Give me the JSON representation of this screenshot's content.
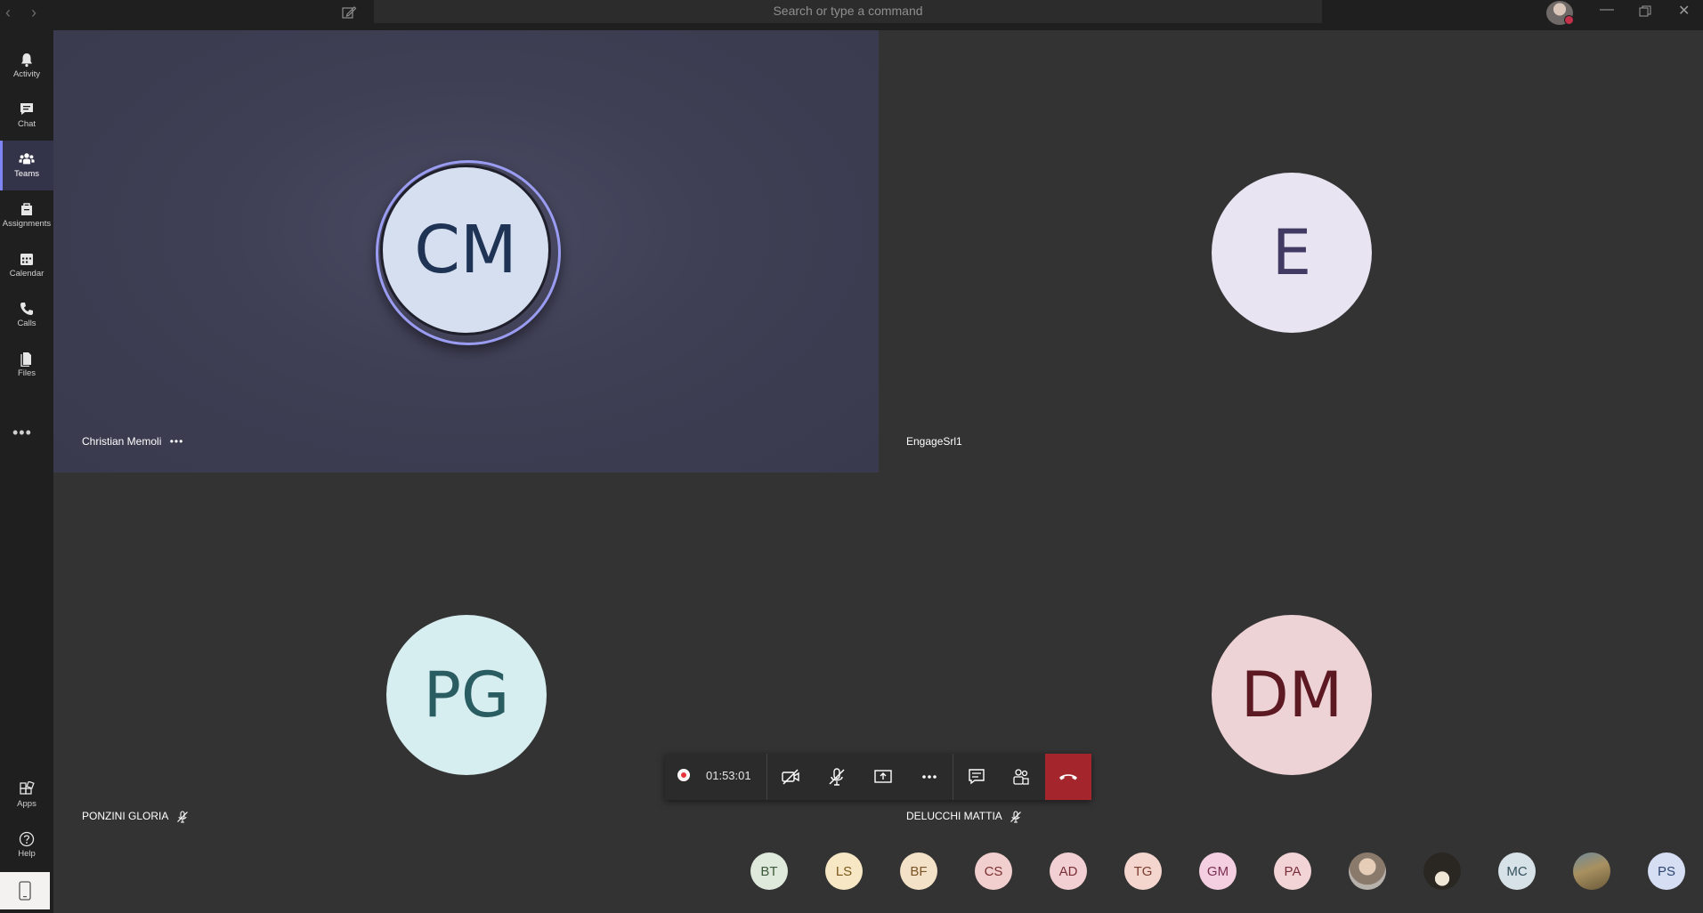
{
  "titlebar": {
    "search_placeholder": "Search or type a command",
    "back_icon": "chevron-left-icon",
    "forward_icon": "chevron-right-icon",
    "compose_icon": "compose-icon"
  },
  "rail": {
    "items": [
      {
        "label": "Activity",
        "icon": "bell-icon"
      },
      {
        "label": "Chat",
        "icon": "chat-icon"
      },
      {
        "label": "Teams",
        "icon": "teams-icon",
        "active": true
      },
      {
        "label": "Assignments",
        "icon": "assignments-icon"
      },
      {
        "label": "Calendar",
        "icon": "calendar-icon"
      },
      {
        "label": "Calls",
        "icon": "phone-icon"
      },
      {
        "label": "Files",
        "icon": "files-icon"
      }
    ],
    "bottom": [
      {
        "label": "Apps",
        "icon": "apps-icon"
      },
      {
        "label": "Help",
        "icon": "help-icon"
      }
    ]
  },
  "participants": [
    {
      "initials": "CM",
      "name": "Christian Memoli",
      "speaking": true,
      "muted": false,
      "avatar_bg": "#d6dff0",
      "avatar_fg": "#1f3354"
    },
    {
      "initials": "E",
      "name": "EngageSrl1",
      "speaking": false,
      "muted": false,
      "avatar_bg": "#e8e4f2",
      "avatar_fg": "#413a63"
    },
    {
      "initials": "PG",
      "name": "PONZINI GLORIA",
      "speaking": false,
      "muted": true,
      "avatar_bg": "#d7eef0",
      "avatar_fg": "#2a5d62"
    },
    {
      "initials": "DM",
      "name": "DELUCCHI MATTIA",
      "speaking": false,
      "muted": true,
      "avatar_bg": "#edd3d6",
      "avatar_fg": "#5c1922"
    }
  ],
  "controls": {
    "timer": "01:53:01",
    "buttons": [
      "video-off-icon",
      "mic-off-icon",
      "share-screen-icon",
      "more-icon",
      "chat-icon",
      "participants-icon",
      "hang-up-icon"
    ]
  },
  "roster": [
    {
      "initials": "BT",
      "bg": "#dfe9dc",
      "fg": "#3c5a3a"
    },
    {
      "initials": "LS",
      "bg": "#f7e7c4",
      "fg": "#7a5a1c"
    },
    {
      "initials": "BF",
      "bg": "#f4e2c8",
      "fg": "#7a5426"
    },
    {
      "initials": "CS",
      "bg": "#f2cfcf",
      "fg": "#7a2f2f"
    },
    {
      "initials": "AD",
      "bg": "#f2cfd3",
      "fg": "#7a2f38"
    },
    {
      "initials": "TG",
      "bg": "#f4d6cf",
      "fg": "#7a3d2f"
    },
    {
      "initials": "GM",
      "bg": "#f4cfe1",
      "fg": "#7a2f52"
    },
    {
      "initials": "PA",
      "bg": "#f2d3d6",
      "fg": "#7a2f3a"
    },
    {
      "initials": "",
      "photo": true,
      "bg": "#9a8f86"
    },
    {
      "initials": "",
      "photo": true,
      "bg": "#3a3632"
    },
    {
      "initials": "MC",
      "bg": "#d7e2e8",
      "fg": "#35505c"
    },
    {
      "initials": "",
      "photo": true,
      "bg": "#8a7c60"
    },
    {
      "initials": "PS",
      "bg": "#d5def2",
      "fg": "#2f4570"
    }
  ]
}
